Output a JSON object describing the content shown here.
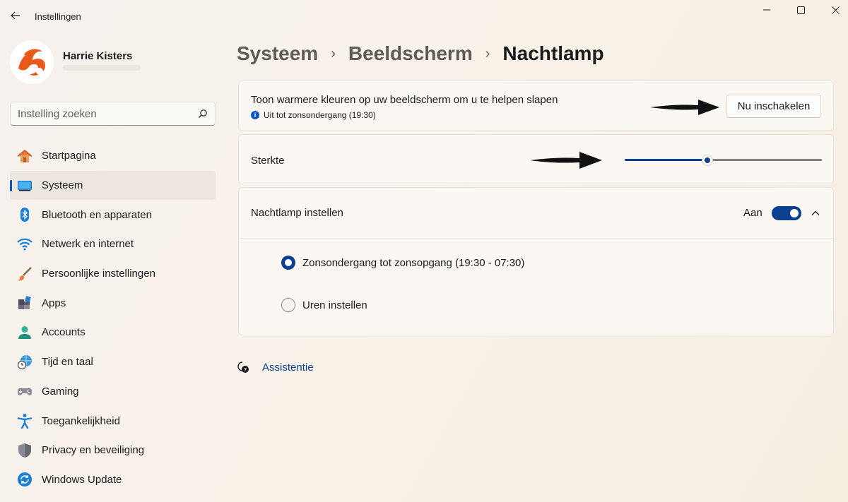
{
  "window": {
    "title": "Instellingen"
  },
  "profile": {
    "name": "Harrie Kisters"
  },
  "search": {
    "placeholder": "Instelling zoeken"
  },
  "sidebar": {
    "items": [
      {
        "label": "Startpagina",
        "icon": "home-icon"
      },
      {
        "label": "Systeem",
        "icon": "system-icon",
        "active": true
      },
      {
        "label": "Bluetooth en apparaten",
        "icon": "bluetooth-icon"
      },
      {
        "label": "Netwerk en internet",
        "icon": "wifi-icon"
      },
      {
        "label": "Persoonlijke instellingen",
        "icon": "brush-icon"
      },
      {
        "label": "Apps",
        "icon": "apps-icon"
      },
      {
        "label": "Accounts",
        "icon": "accounts-icon"
      },
      {
        "label": "Tijd en taal",
        "icon": "time-language-icon"
      },
      {
        "label": "Gaming",
        "icon": "gaming-icon"
      },
      {
        "label": "Toegankelijkheid",
        "icon": "accessibility-icon"
      },
      {
        "label": "Privacy en beveiliging",
        "icon": "shield-icon"
      },
      {
        "label": "Windows Update",
        "icon": "update-icon"
      }
    ]
  },
  "breadcrumb": {
    "level1": "Systeem",
    "level2": "Beeldscherm",
    "current": "Nachtlamp"
  },
  "nightlight": {
    "description": "Toon warmere kleuren op uw beeldscherm om u te helpen slapen",
    "status": "Uit tot zonsondergang (19:30)",
    "button_label": "Nu inschakelen"
  },
  "strength": {
    "label": "Sterkte",
    "value_fraction": 0.42
  },
  "schedule": {
    "label": "Nachtlamp instellen",
    "toggle_label": "Aan",
    "toggle_on": true,
    "options": [
      {
        "label": "Zonsondergang tot zonsopgang (19:30 - 07:30)",
        "selected": true
      },
      {
        "label": "Uren instellen",
        "selected": false
      }
    ]
  },
  "help": {
    "label": "Assistentie"
  },
  "colors": {
    "accent": "#0b3f8f",
    "link": "#0a3f8f"
  }
}
